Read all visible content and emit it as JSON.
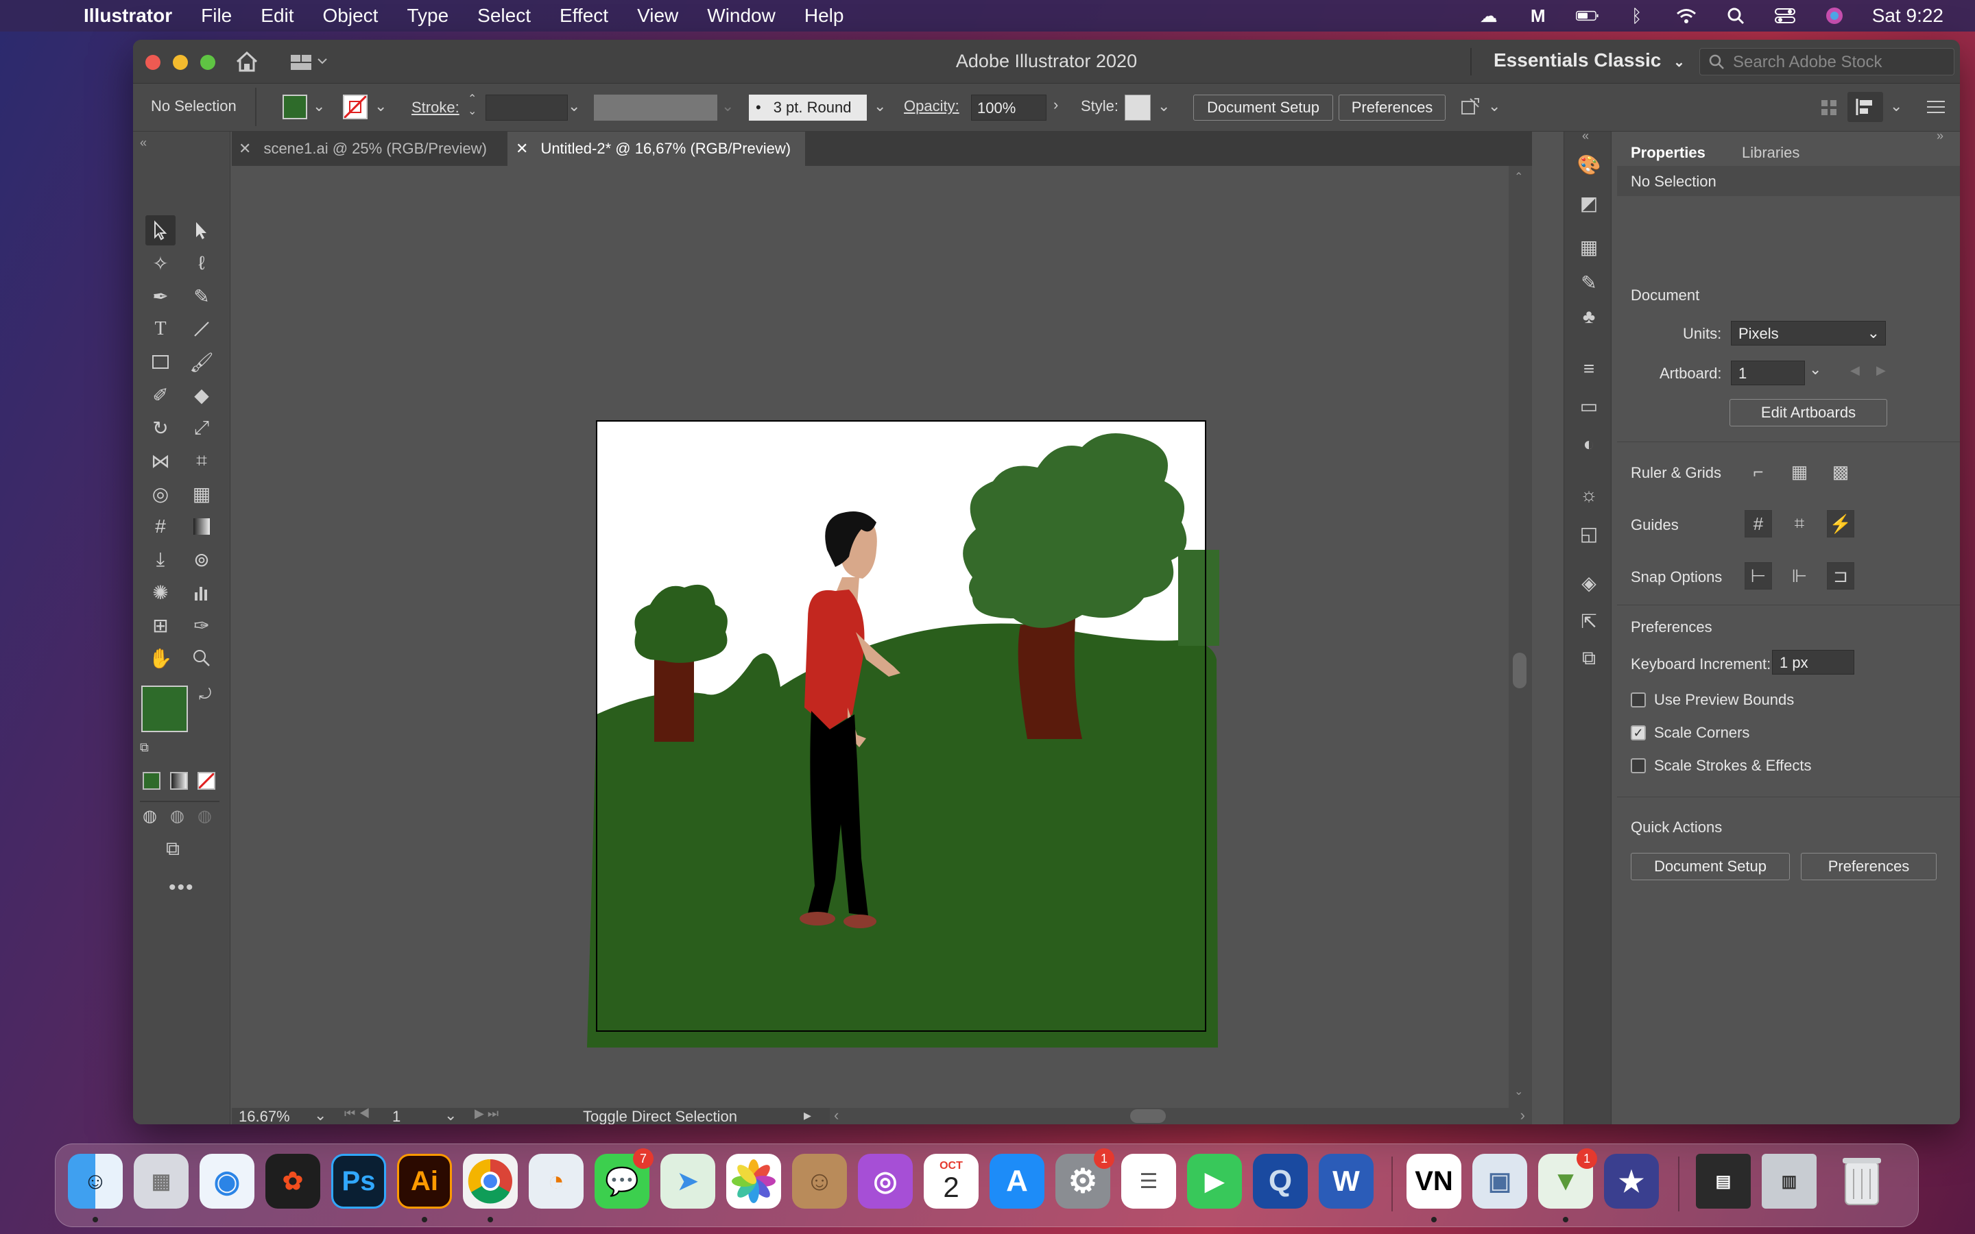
{
  "menubar": {
    "app_name": "Illustrator",
    "items": [
      "File",
      "Edit",
      "Object",
      "Type",
      "Select",
      "Effect",
      "View",
      "Window",
      "Help"
    ],
    "clock": "Sat 9:22"
  },
  "window": {
    "title": "Adobe Illustrator 2020",
    "workspace": "Essentials Classic",
    "search_placeholder": "Search Adobe Stock"
  },
  "control_bar": {
    "selection": "No Selection",
    "fill_color": "#2e6b2a",
    "stroke_label": "Stroke:",
    "brush": "3 pt. Round",
    "opacity_label": "Opacity:",
    "opacity_value": "100%",
    "style_label": "Style:",
    "document_setup": "Document Setup",
    "preferences": "Preferences"
  },
  "tabs": [
    {
      "label": "scene1.ai @ 25% (RGB/Preview)",
      "active": false
    },
    {
      "label": "Untitled-2* @ 16,67% (RGB/Preview)",
      "active": true
    }
  ],
  "status_bar": {
    "zoom": "16.67%",
    "artboard": "1",
    "message": "Toggle Direct Selection"
  },
  "properties_panel": {
    "tab_properties": "Properties",
    "tab_libraries": "Libraries",
    "selection": "No Selection",
    "document_heading": "Document",
    "units_label": "Units:",
    "units_value": "Pixels",
    "artboard_label": "Artboard:",
    "artboard_value": "1",
    "edit_artboards": "Edit Artboards",
    "ruler_grids": "Ruler & Grids",
    "guides": "Guides",
    "snap_options": "Snap Options",
    "preferences_heading": "Preferences",
    "keyboard_increment_label": "Keyboard Increment:",
    "keyboard_increment_value": "1 px",
    "checkboxes": [
      {
        "label": "Use Preview Bounds",
        "checked": false
      },
      {
        "label": "Scale Corners",
        "checked": true
      },
      {
        "label": "Scale Strokes & Effects",
        "checked": false
      }
    ],
    "quick_actions": "Quick Actions",
    "document_setup": "Document Setup",
    "preferences": "Preferences"
  },
  "dock": {
    "badges": {
      "messages": "7",
      "system_preferences": "1",
      "installer": "1"
    },
    "calendar_month": "OCT",
    "calendar_day": "2",
    "vn_label": "VN",
    "ps_label": "Ps",
    "ai_label": "Ai"
  },
  "colors": {
    "grass": "#2a5e1c",
    "tree_foliage": "#356a2a",
    "trunk": "#5a1b0c",
    "shirt": "#c3271f",
    "skin": "#d8a88a"
  }
}
